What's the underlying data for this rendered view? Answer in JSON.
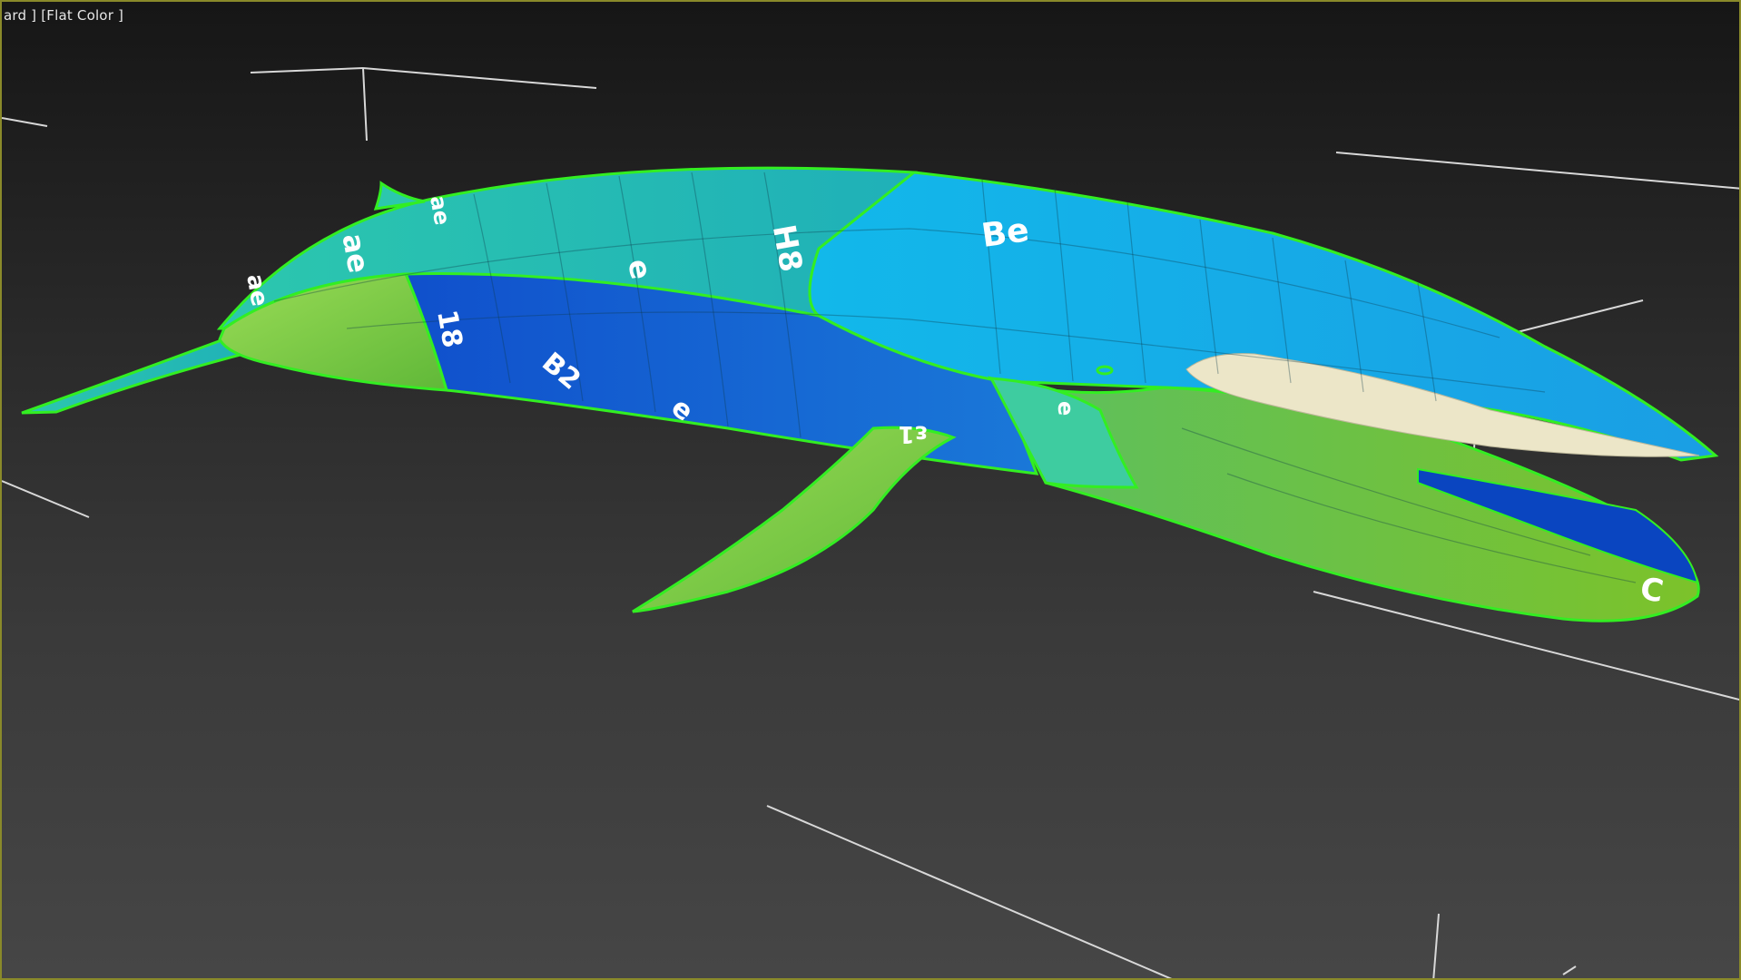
{
  "viewport": {
    "label": "ard ] [Flat Color ]",
    "border_color": "#8a8a2a",
    "background_top": "#161616",
    "background_bottom": "#464646"
  },
  "model": {
    "name": "whale",
    "seam_color": "#33ee22",
    "uv_labels": [
      "ae",
      "ae",
      "ae",
      "H8",
      "Be",
      "e",
      "18",
      "B2",
      "e",
      "ε1",
      "e",
      "C"
    ]
  },
  "colors": {
    "teal": "#1fb8a8",
    "cyan": "#18c8e8",
    "sky": "#1ea6e6",
    "blue": "#1060d0",
    "deep_blue": "#0a45c0",
    "green": "#6cc23c",
    "light_green": "#8ed84a",
    "baleen": "#ece6c8",
    "grid_lines": "#ffffff"
  }
}
